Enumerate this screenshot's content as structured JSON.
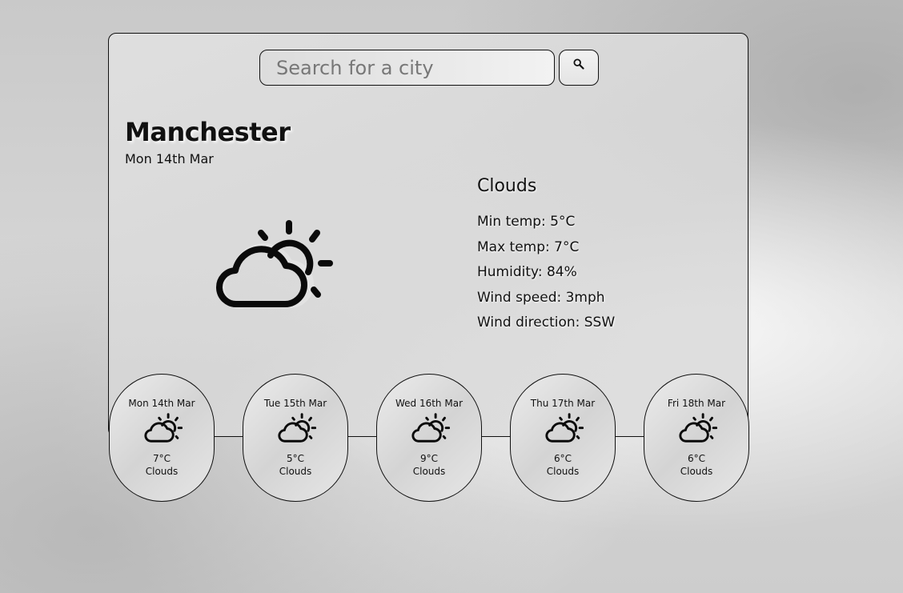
{
  "search": {
    "placeholder": "Search for a city",
    "value": ""
  },
  "icons": {
    "search": "search-icon",
    "weather": "partly-cloudy-icon"
  },
  "current": {
    "city": "Manchester",
    "date": "Mon 14th Mar",
    "condition": "Clouds",
    "stats": [
      "Min temp: 5°C",
      "Max temp: 7°C",
      "Humidity: 84%",
      "Wind speed: 3mph",
      "Wind direction: SSW"
    ]
  },
  "forecast": [
    {
      "date": "Mon 14th Mar",
      "temp": "7°C",
      "condition": "Clouds"
    },
    {
      "date": "Tue 15th Mar",
      "temp": "5°C",
      "condition": "Clouds"
    },
    {
      "date": "Wed 16th Mar",
      "temp": "9°C",
      "condition": "Clouds"
    },
    {
      "date": "Thu 17th Mar",
      "temp": "6°C",
      "condition": "Clouds"
    },
    {
      "date": "Fri 18th Mar",
      "temp": "6°C",
      "condition": "Clouds"
    }
  ]
}
